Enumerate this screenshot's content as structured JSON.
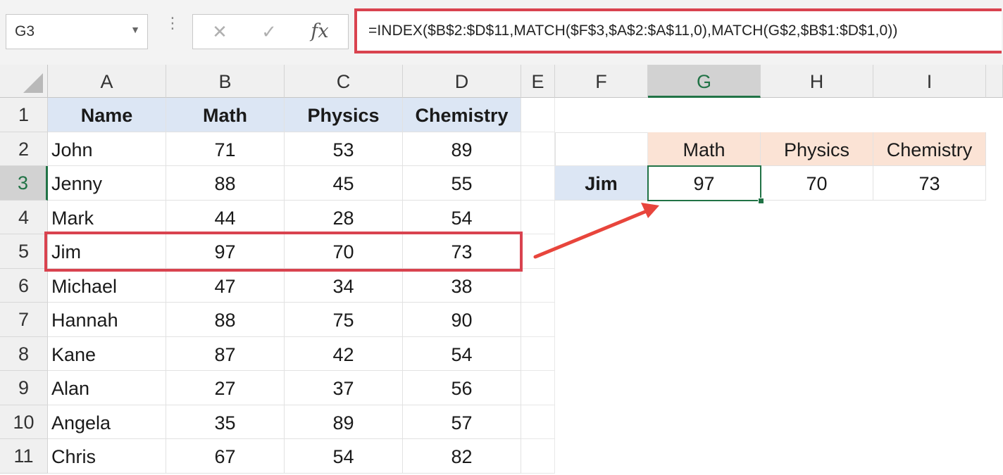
{
  "formula_bar": {
    "name_box": "G3",
    "name_box_dropdown_icon": "chevron-down-icon",
    "more_icon": "vertical-dots-icon",
    "cancel_icon": "close-icon",
    "enter_icon": "checkmark-icon",
    "fx_label": "fx",
    "formula": "=INDEX($B$2:$D$11,MATCH($F$3,$A$2:$A$11,0),MATCH(G$2,$B$1:$D$1,0))"
  },
  "columns": [
    "A",
    "B",
    "C",
    "D",
    "E",
    "F",
    "G",
    "H",
    "I"
  ],
  "rows": [
    "1",
    "2",
    "3",
    "4",
    "5",
    "6",
    "7",
    "8",
    "9",
    "10",
    "11"
  ],
  "table": {
    "headers": [
      "Name",
      "Math",
      "Physics",
      "Chemistry"
    ],
    "rows": [
      [
        "John",
        "71",
        "53",
        "89"
      ],
      [
        "Jenny",
        "88",
        "45",
        "55"
      ],
      [
        "Mark",
        "44",
        "28",
        "54"
      ],
      [
        "Jim",
        "97",
        "70",
        "73"
      ],
      [
        "Michael",
        "47",
        "34",
        "38"
      ],
      [
        "Hannah",
        "88",
        "75",
        "90"
      ],
      [
        "Kane",
        "87",
        "42",
        "54"
      ],
      [
        "Alan",
        "27",
        "37",
        "56"
      ],
      [
        "Angela",
        "35",
        "89",
        "57"
      ],
      [
        "Chris",
        "67",
        "54",
        "82"
      ]
    ]
  },
  "lookup": {
    "headers": [
      "Math",
      "Physics",
      "Chemistry"
    ],
    "label": "Jim",
    "values": [
      "97",
      "70",
      "73"
    ]
  },
  "active_cell": "G3",
  "colors": {
    "accent_green": "#217346",
    "highlight_red": "#d9434f",
    "header_blue": "#dce6f4",
    "header_peach": "#fbe3d5"
  }
}
